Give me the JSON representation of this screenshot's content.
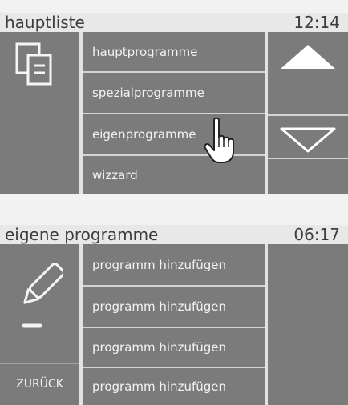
{
  "screen_main": {
    "title": "hauptliste",
    "clock": "12:14",
    "menu": [
      "hauptprogramme",
      "spezialprogramme",
      "eigenprogramme",
      "wizzard"
    ],
    "icons": {
      "left": "documents-icon",
      "up": "arrow-up-icon",
      "down": "arrow-down-icon",
      "pointer": "hand-pointer-icon"
    }
  },
  "screen_own": {
    "title": "eigene programme",
    "clock": "06:17",
    "menu": [
      "programm hinzufügen",
      "programm hinzufügen",
      "programm hinzufügen",
      "programm hinzufügen"
    ],
    "back_label": "ZURÜCK",
    "icons": {
      "left": "pencil-icon"
    }
  }
}
